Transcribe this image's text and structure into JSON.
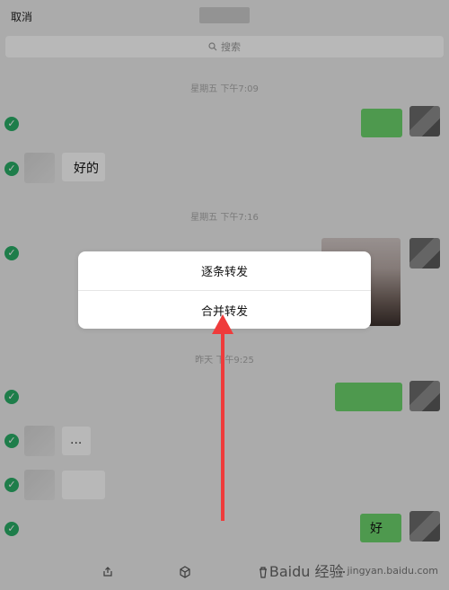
{
  "header": {
    "cancel_label": "取消"
  },
  "search": {
    "placeholder": "搜索"
  },
  "timestamps": [
    "星期五 下午7:09",
    "星期五 下午7:16",
    "昨天 下午9:25"
  ],
  "messages": {
    "reply_text": "好的",
    "ellipsis_text": "...",
    "green_final_text": "好"
  },
  "dialog": {
    "option1": "逐条转发",
    "option2": "合并转发"
  },
  "watermark": {
    "brand": "Baidu 经验",
    "url": "jingyan.baidu.com"
  },
  "icons": {
    "check": "check-icon",
    "search": "search-icon",
    "share": "share-icon",
    "box": "cube-icon",
    "trash": "trash-icon",
    "more": "more-icon"
  },
  "colors": {
    "accent_green": "#2aae67",
    "bubble_green": "#6cd46c",
    "overlay": "rgba(0,0,0,0.28)"
  }
}
